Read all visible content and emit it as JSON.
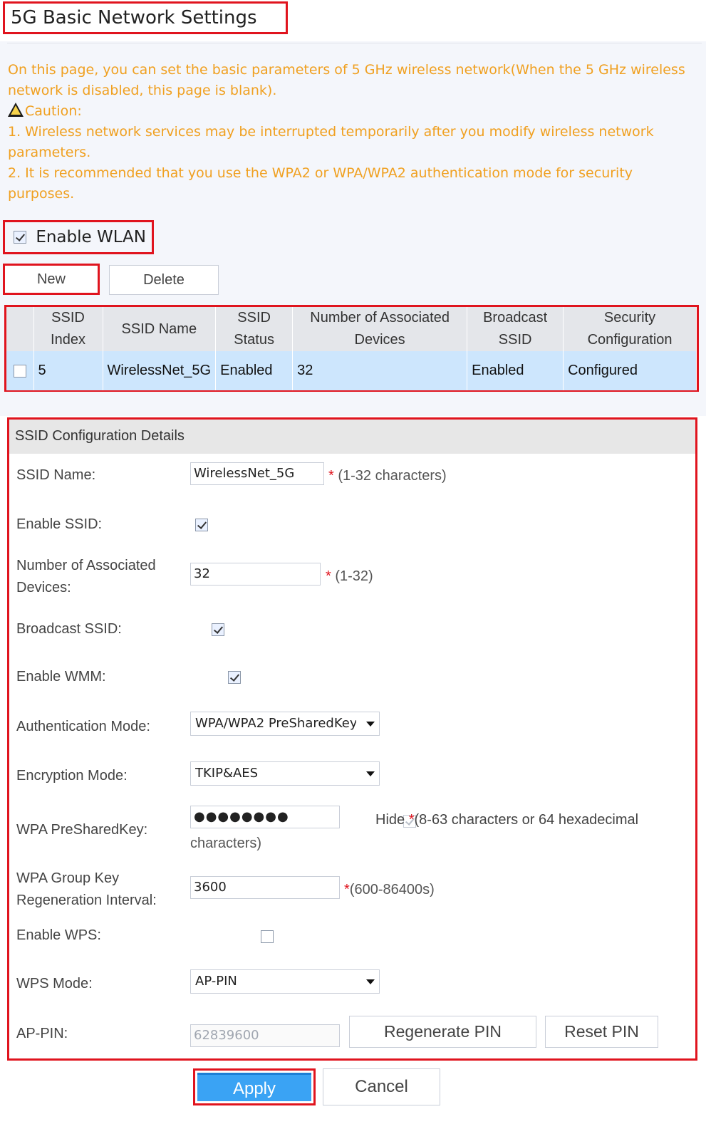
{
  "page": {
    "title": "5G Basic Network Settings",
    "notice_line1": "On this page, you can set the basic parameters of 5 GHz wireless network(When the 5 GHz wireless",
    "notice_line2": "network is disabled, this page is blank).",
    "caution": "Caution:",
    "caution_1a": "1. Wireless network services may be interrupted temporarily after you modify wireless network",
    "caution_1b": "parameters.",
    "caution_2a": "2. It is recommended that you use the WPA2 or WPA/WPA2 authentication mode for security",
    "caution_2b": "purposes."
  },
  "wlan": {
    "enable_label": "Enable WLAN",
    "enabled": true
  },
  "toolbar": {
    "new_label": "New",
    "delete_label": "Delete"
  },
  "ssid_table": {
    "headers": {
      "index_1": "SSID",
      "index_2": "Index",
      "name": "SSID Name",
      "status_1": "SSID",
      "status_2": "Status",
      "devices_1": "Number of Associated",
      "devices_2": "Devices",
      "broadcast_1": "Broadcast",
      "broadcast_2": "SSID",
      "security_1": "Security",
      "security_2": "Configuration"
    },
    "rows": [
      {
        "index": "5",
        "name": "WirelessNet_5G",
        "status": "Enabled",
        "devices": "32",
        "broadcast": "Enabled",
        "security": "Configured"
      }
    ]
  },
  "config": {
    "header": "SSID Configuration Details",
    "ssid_name": {
      "label": "SSID Name:",
      "value": "WirelessNet_5G",
      "hint": "(1-32 characters)"
    },
    "enable_ssid": {
      "label": "Enable SSID:",
      "checked": true
    },
    "assoc_devices": {
      "label_1": "Number of Associated",
      "label_2": "Devices:",
      "value": "32",
      "hint": "(1-32)"
    },
    "broadcast_ssid": {
      "label": "Broadcast SSID:",
      "checked": true
    },
    "enable_wmm": {
      "label": "Enable WMM:",
      "checked": true
    },
    "auth_mode": {
      "label": "Authentication Mode:",
      "value": "WPA/WPA2 PreSharedKey"
    },
    "encryption_mode": {
      "label": "Encryption Mode:",
      "value": "TKIP&AES"
    },
    "psk": {
      "label": "WPA PreSharedKey:",
      "value": "●●●●●●●●",
      "hide_label": "Hide",
      "hint_1": "(8-63 characters or 64 hexadecimal",
      "hint_2": "characters)"
    },
    "group_key": {
      "label_1": "WPA Group Key",
      "label_2": "Regeneration Interval:",
      "value": "3600",
      "hint": "(600-86400s)"
    },
    "enable_wps": {
      "label": "Enable WPS:",
      "checked": false
    },
    "wps_mode": {
      "label": "WPS Mode:",
      "value": "AP-PIN"
    },
    "ap_pin": {
      "label": "AP-PIN:",
      "value": "62839600",
      "regenerate_label": "Regenerate PIN",
      "reset_label": "Reset PIN"
    }
  },
  "actions": {
    "apply_label": "Apply",
    "cancel_label": "Cancel"
  },
  "colors": {
    "accent": "#3aa3f4",
    "notice": "#f0a020",
    "highlight": "#e0141e",
    "row_selected": "#cde6fd"
  }
}
